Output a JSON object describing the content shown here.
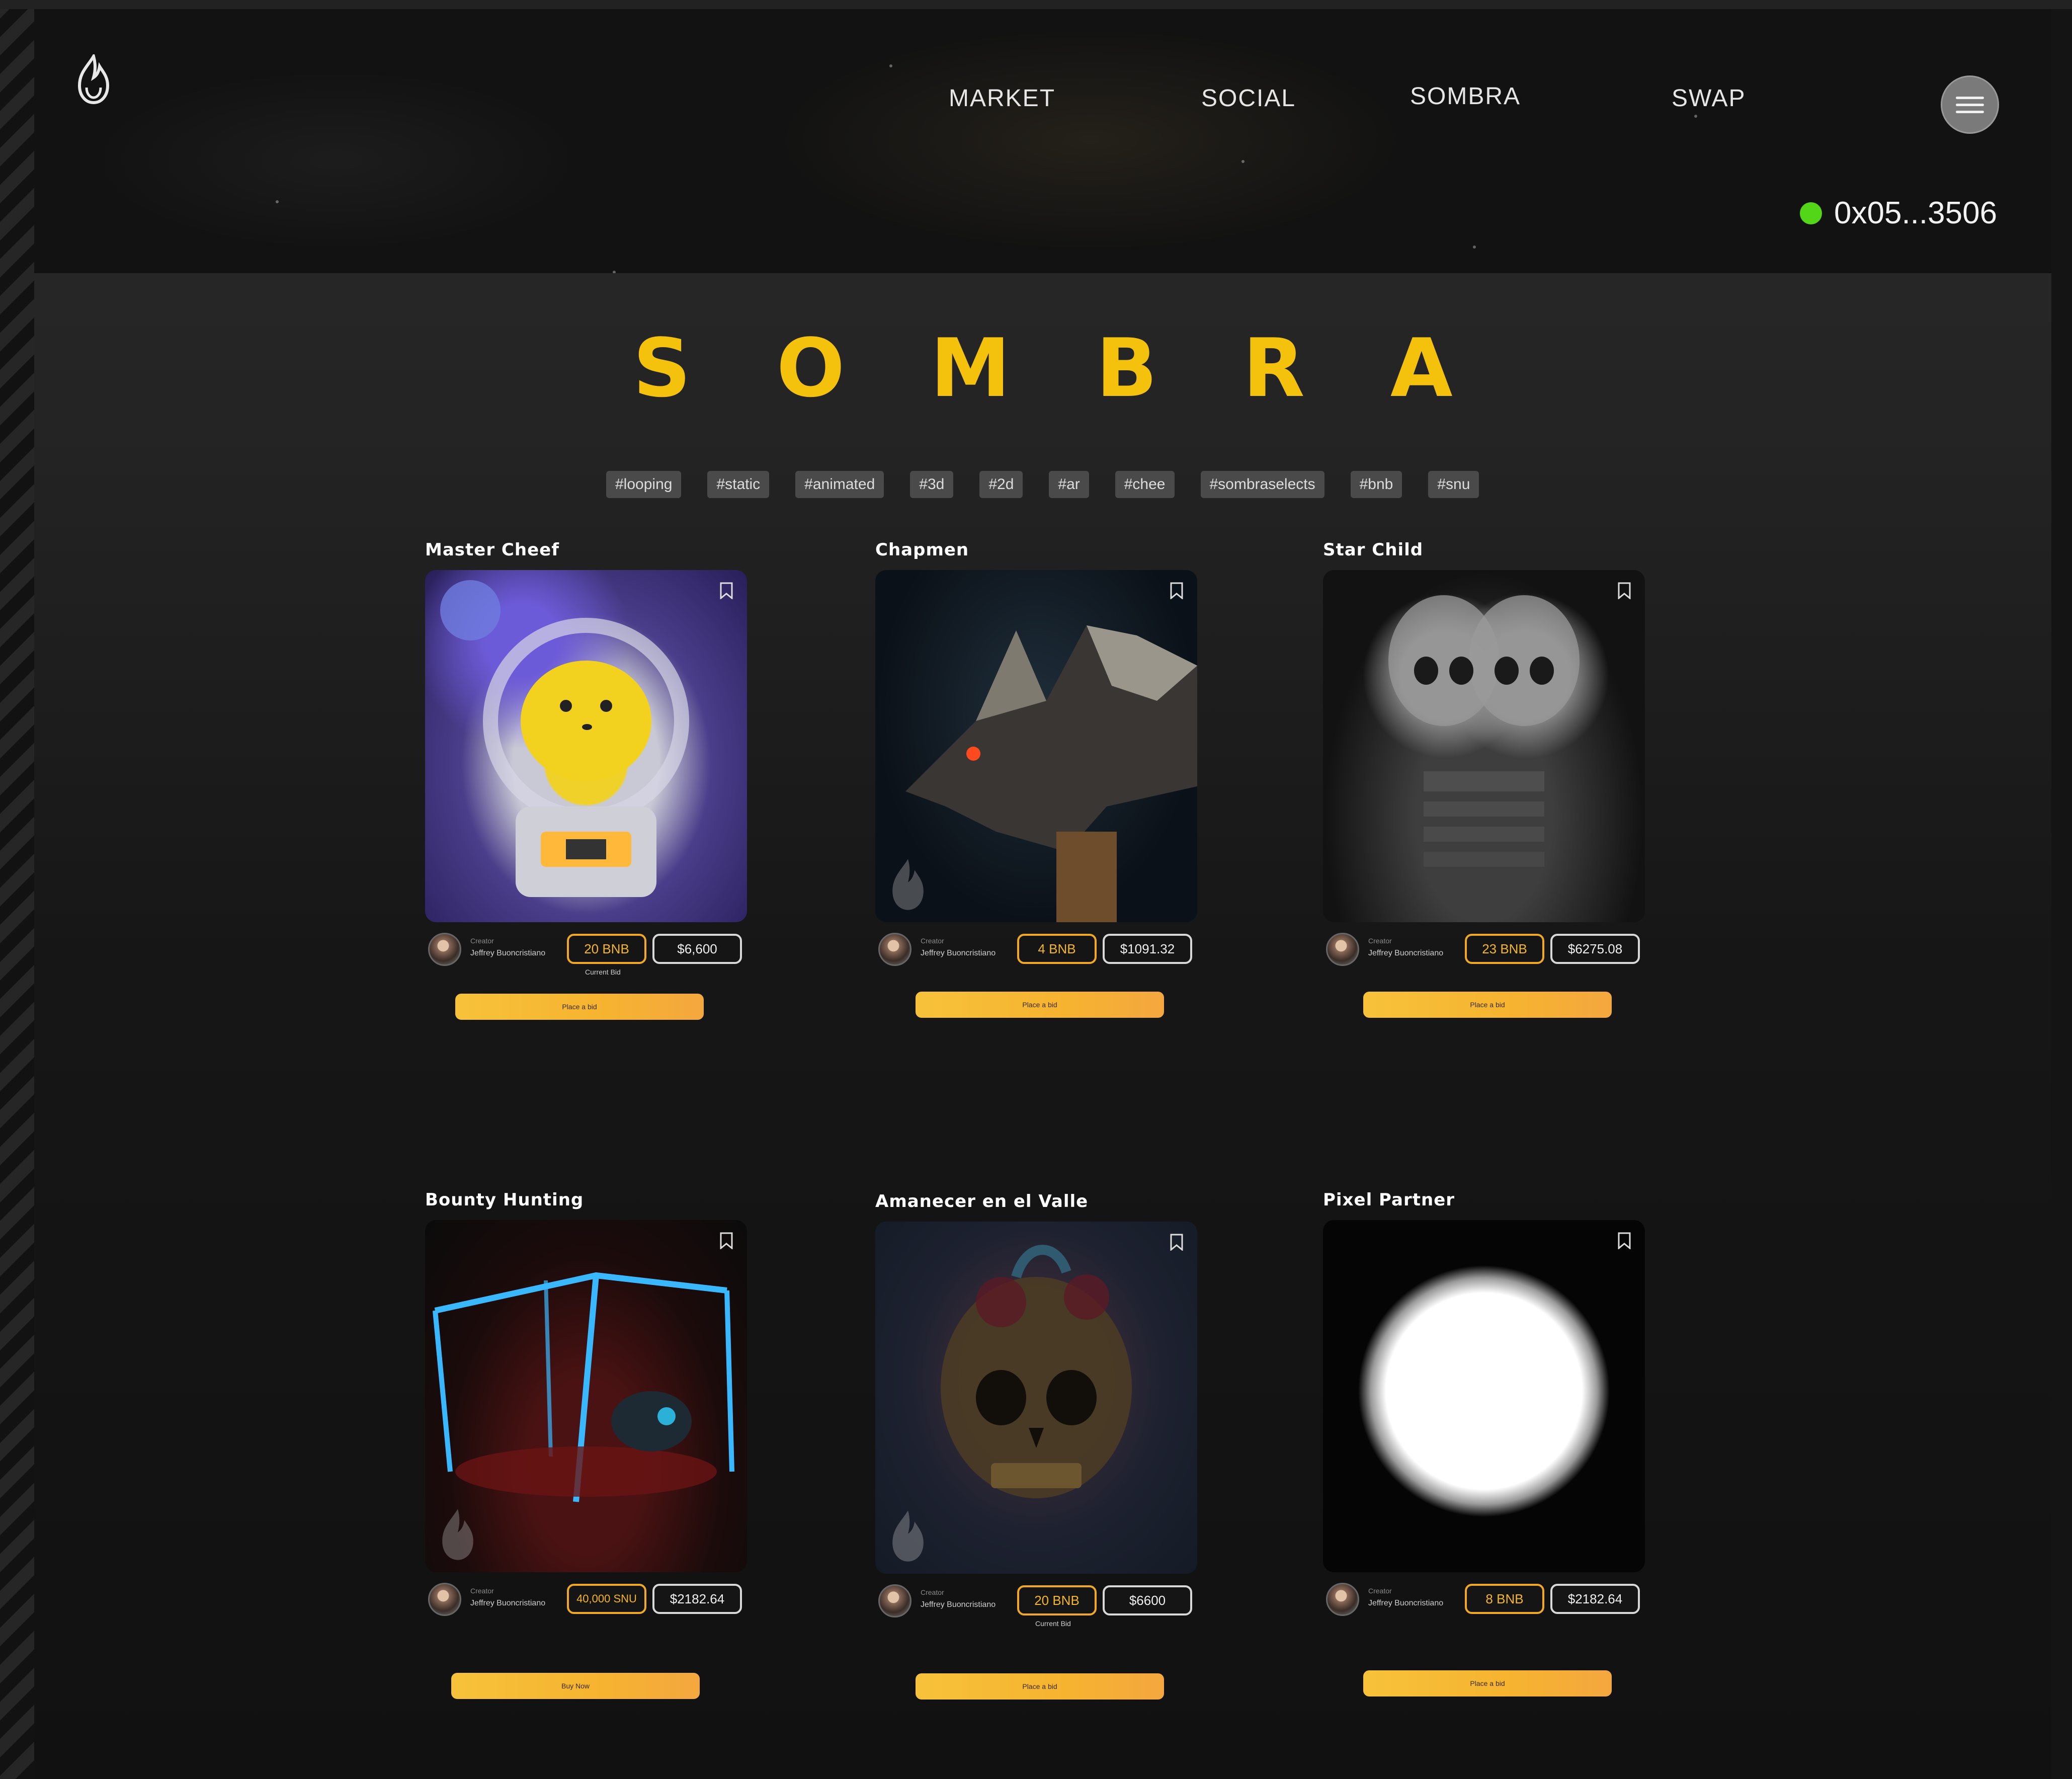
{
  "header": {
    "nav": [
      {
        "label": "MARKET"
      },
      {
        "label": "SOCIAL"
      },
      {
        "label": "SOMBRA"
      },
      {
        "label": "SWAP"
      }
    ],
    "wallet_address": "0x05...3506",
    "wallet_status_color": "#52d617"
  },
  "page_title": "SOMBRA",
  "tags": [
    "#looping",
    "#static",
    "#animated",
    "#3d",
    "#2d",
    "#ar",
    "#chee",
    "#sombraselects",
    "#bnb",
    "#snu"
  ],
  "cards": [
    {
      "title": "Master Cheef",
      "creator_label": "Creator",
      "creator_name": "Jeffrey Buoncristiano",
      "price_token": "20 BNB",
      "price_usd": "$6,600",
      "current_bid": "Current Bid",
      "action": "Place a bid"
    },
    {
      "title": "Chapmen",
      "creator_label": "Creator",
      "creator_name": "Jeffrey Buoncristiano",
      "price_token": "4 BNB",
      "price_usd": "$1091.32",
      "current_bid": "",
      "action": "Place a bid"
    },
    {
      "title": "Star Child",
      "creator_label": "Creator",
      "creator_name": "Jeffrey Buoncristiano",
      "price_token": "23 BNB",
      "price_usd": "$6275.08",
      "current_bid": "",
      "action": "Place a bid"
    },
    {
      "title": "Bounty Hunting",
      "creator_label": "Creator",
      "creator_name": "Jeffrey Buoncristiano",
      "price_token": "40,000 SNU",
      "price_usd": "$2182.64",
      "current_bid": "",
      "action": "Buy Now"
    },
    {
      "title": "Amanecer en el Valle",
      "creator_label": "Creator",
      "creator_name": "Jeffrey Buoncristiano",
      "price_token": "20 BNB",
      "price_usd": "$6600",
      "current_bid": "Current Bid",
      "action": "Place a bid"
    },
    {
      "title": "Pixel Partner",
      "creator_label": "Creator",
      "creator_name": "Jeffrey Buoncristiano",
      "price_token": "8 BNB",
      "price_usd": "$2182.64",
      "current_bid": "",
      "action": "Place a bid"
    }
  ],
  "icons": {
    "logo": "flame-logo-icon",
    "menu": "hamburger-menu-icon",
    "bookmark": "bookmark-icon",
    "watermark": "flame-watermark-icon"
  },
  "colors": {
    "accent": "#f4c20d",
    "button": "#f6b330",
    "background": "#141414"
  }
}
